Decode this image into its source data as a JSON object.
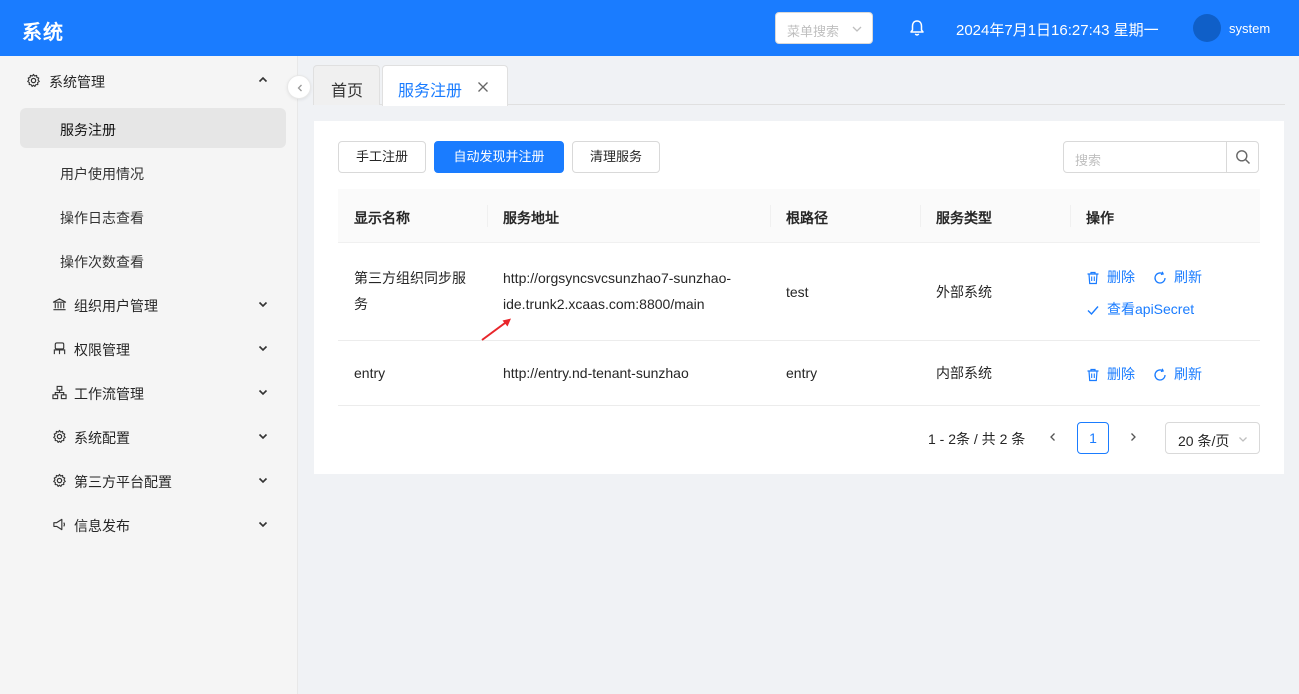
{
  "header": {
    "title": "系统",
    "menu_search_placeholder": "菜单搜索",
    "datetime": "2024年7月1日16:27:43 星期一",
    "username": "system",
    "icons": [
      "chevron-down-icon",
      "bell-icon"
    ]
  },
  "sidebar": {
    "section": "系统管理",
    "items": [
      {
        "label": "服务注册",
        "active": true
      },
      {
        "label": "用户使用情况"
      },
      {
        "label": "操作日志查看"
      },
      {
        "label": "操作次数查看"
      }
    ],
    "groups": [
      {
        "label": "组织用户管理",
        "icon": "bank-icon"
      },
      {
        "label": "权限管理",
        "icon": "user-lock-icon"
      },
      {
        "label": "工作流管理",
        "icon": "workflow-icon"
      },
      {
        "label": "系统配置",
        "icon": "gear-icon"
      },
      {
        "label": "第三方平台配置",
        "icon": "gear-icon"
      },
      {
        "label": "信息发布",
        "icon": "megaphone-icon"
      }
    ]
  },
  "tabs": [
    {
      "label": "首页"
    },
    {
      "label": "服务注册",
      "active": true
    }
  ],
  "toolbar": {
    "manual_register": "手工注册",
    "auto_discover": "自动发现并注册",
    "clean_services": "清理服务",
    "search_placeholder": "搜索"
  },
  "table": {
    "columns": [
      "显示名称",
      "服务地址",
      "根路径",
      "服务类型",
      "操作"
    ],
    "rows": [
      {
        "name_line1": "第三方组织同步服",
        "name_line2": "务",
        "address_line1": "http://orgsyncsvcsunzhao7-sunzhao-",
        "address_line2": "ide.trunk2.xcaas.com:8800/main",
        "root_path": "test",
        "type": "外部系统",
        "actions": [
          "删除",
          "刷新",
          "查看apiSecret"
        ]
      },
      {
        "name": "entry",
        "address": "http://entry.nd-tenant-sunzhao",
        "root_path": "entry",
        "type": "内部系统",
        "actions": [
          "删除",
          "刷新"
        ]
      }
    ]
  },
  "pagination": {
    "total_text": "1 - 2条 / 共 2 条",
    "current_page": "1",
    "page_size": "20 条/页"
  },
  "colors": {
    "primary": "#1a7cff",
    "annotation_arrow": "#e8262b"
  }
}
